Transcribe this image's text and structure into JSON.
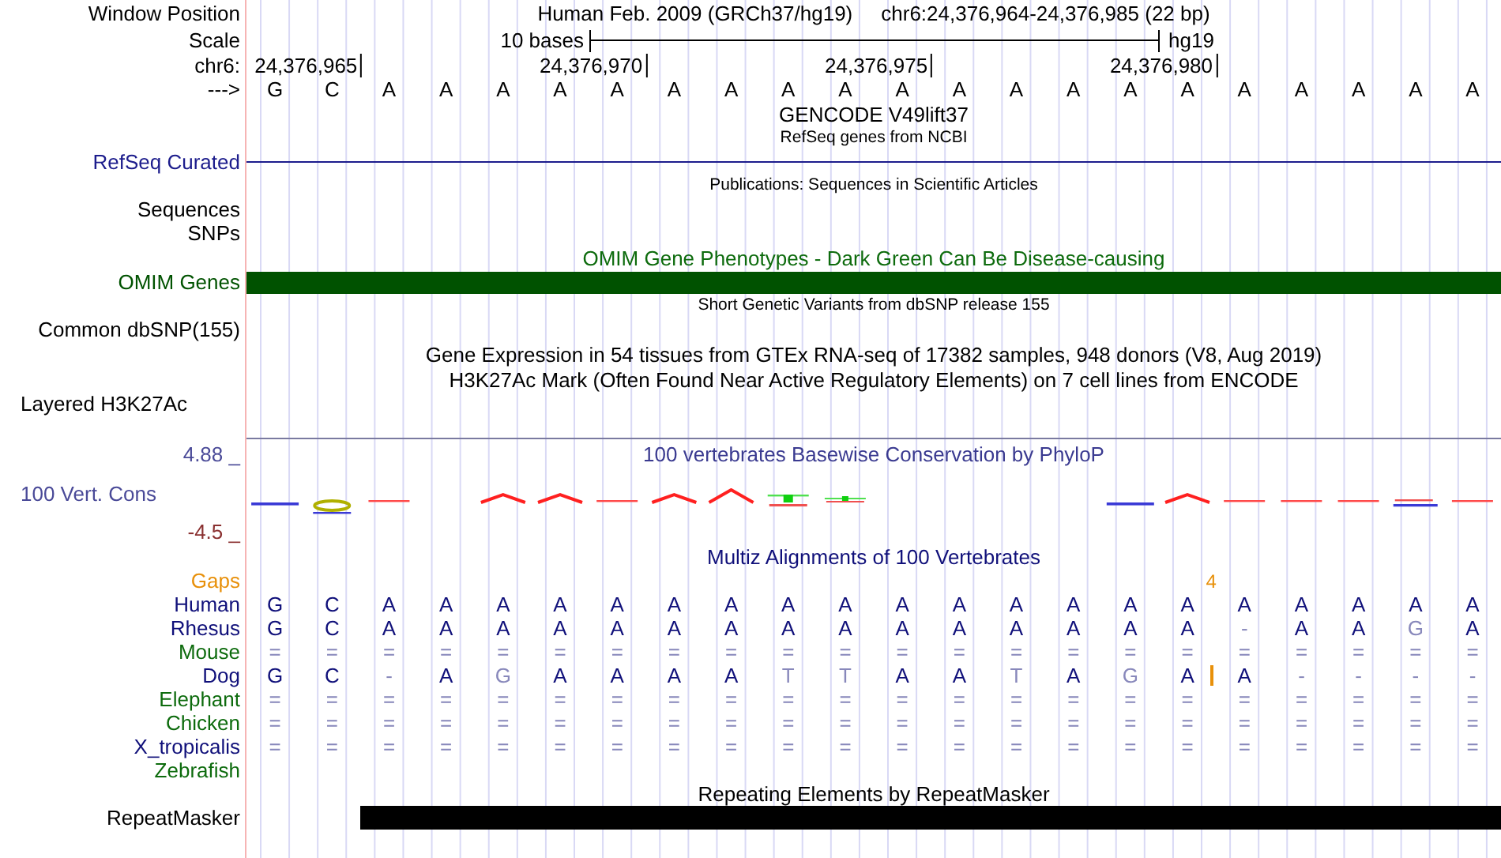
{
  "header": {
    "label": "Window Position",
    "title": "Human Feb. 2009 (GRCh37/hg19)",
    "position": "chr6:24,376,964-24,376,985 (22 bp)"
  },
  "scale": {
    "label": "Scale",
    "length": "10 bases",
    "assembly": "hg19"
  },
  "ruler": {
    "label": "chr6:",
    "ticks": [
      "24,376,965",
      "24,376,970",
      "24,376,975",
      "24,376,980"
    ]
  },
  "sequence": {
    "label": "--->",
    "bases": [
      "G",
      "C",
      "A",
      "A",
      "A",
      "A",
      "A",
      "A",
      "A",
      "A",
      "A",
      "A",
      "A",
      "A",
      "A",
      "A",
      "A",
      "A",
      "A",
      "A",
      "A",
      "A"
    ]
  },
  "tracks": [
    {
      "kind": "title",
      "text": "GENCODE V49lift37"
    },
    {
      "kind": "note",
      "text": "RefSeq genes from NCBI"
    },
    {
      "kind": "line",
      "label": "RefSeq Curated",
      "color": "#1c1c8c"
    },
    {
      "kind": "note",
      "text": "Publications: Sequences in Scientific Articles"
    },
    {
      "kind": "label",
      "label": "Sequences"
    },
    {
      "kind": "label",
      "label": "SNPs"
    },
    {
      "kind": "title",
      "text": "OMIM Gene Phenotypes - Dark Green Can Be Disease-causing",
      "color": "#0d6b0d"
    },
    {
      "kind": "bar",
      "label": "OMIM Genes",
      "color": "#005200"
    },
    {
      "kind": "note",
      "text": "Short Genetic Variants from dbSNP release 155"
    },
    {
      "kind": "label",
      "label": "Common dbSNP(155)"
    },
    {
      "kind": "title",
      "text": "Gene Expression in 54 tissues from GTEx RNA-seq of 17382 samples, 948 donors (V8, Aug 2019)"
    },
    {
      "kind": "title",
      "text": "H3K27Ac Mark (Often Found Near Active Regulatory Elements) on 7 cell lines from ENCODE"
    },
    {
      "kind": "left-label",
      "label": "Layered H3K27Ac"
    }
  ],
  "conservation": {
    "title": "100 vertebrates Basewise Conservation by PhyloP",
    "label": "100 Vert. Cons",
    "max": "4.88 _",
    "min": "-4.5 _"
  },
  "alignment": {
    "title": "Multiz Alignments of 100 Vertebrates",
    "gaps": {
      "label": "Gaps",
      "marks": [
        {
          "text": "4"
        }
      ]
    },
    "species": [
      {
        "name": "Human",
        "color": "#10107a",
        "bases": [
          {
            "b": "G",
            "match": true
          },
          {
            "b": "C",
            "match": true
          },
          {
            "b": "A",
            "match": true
          },
          {
            "b": "A",
            "match": true
          },
          {
            "b": "A",
            "match": true
          },
          {
            "b": "A",
            "match": true
          },
          {
            "b": "A",
            "match": true
          },
          {
            "b": "A",
            "match": true
          },
          {
            "b": "A",
            "match": true
          },
          {
            "b": "A",
            "match": true
          },
          {
            "b": "A",
            "match": true
          },
          {
            "b": "A",
            "match": true
          },
          {
            "b": "A",
            "match": true
          },
          {
            "b": "A",
            "match": true
          },
          {
            "b": "A",
            "match": true
          },
          {
            "b": "A",
            "match": true
          },
          {
            "b": "A",
            "match": true
          },
          {
            "b": "A",
            "match": true
          },
          {
            "b": "A",
            "match": true
          },
          {
            "b": "A",
            "match": true
          },
          {
            "b": "A",
            "match": true
          },
          {
            "b": "A",
            "match": true
          }
        ]
      },
      {
        "name": "Rhesus",
        "color": "#10107a",
        "bases": [
          {
            "b": "G",
            "match": true
          },
          {
            "b": "C",
            "match": true
          },
          {
            "b": "A",
            "match": true
          },
          {
            "b": "A",
            "match": true
          },
          {
            "b": "A",
            "match": true
          },
          {
            "b": "A",
            "match": true
          },
          {
            "b": "A",
            "match": true
          },
          {
            "b": "A",
            "match": true
          },
          {
            "b": "A",
            "match": true
          },
          {
            "b": "A",
            "match": true
          },
          {
            "b": "A",
            "match": true
          },
          {
            "b": "A",
            "match": true
          },
          {
            "b": "A",
            "match": true
          },
          {
            "b": "A",
            "match": true
          },
          {
            "b": "A",
            "match": true
          },
          {
            "b": "A",
            "match": true
          },
          {
            "b": "A",
            "match": true
          },
          {
            "b": "-",
            "match": false
          },
          {
            "b": "A",
            "match": true
          },
          {
            "b": "A",
            "match": true
          },
          {
            "b": "G",
            "match": false
          },
          {
            "b": "A",
            "match": true
          }
        ]
      },
      {
        "name": "Mouse",
        "color": "#0d6b0d",
        "bases": [
          {
            "b": "=",
            "match": false
          },
          {
            "b": "=",
            "match": false
          },
          {
            "b": "=",
            "match": false
          },
          {
            "b": "=",
            "match": false
          },
          {
            "b": "=",
            "match": false
          },
          {
            "b": "=",
            "match": false
          },
          {
            "b": "=",
            "match": false
          },
          {
            "b": "=",
            "match": false
          },
          {
            "b": "=",
            "match": false
          },
          {
            "b": "=",
            "match": false
          },
          {
            "b": "=",
            "match": false
          },
          {
            "b": "=",
            "match": false
          },
          {
            "b": "=",
            "match": false
          },
          {
            "b": "=",
            "match": false
          },
          {
            "b": "=",
            "match": false
          },
          {
            "b": "=",
            "match": false
          },
          {
            "b": "=",
            "match": false
          },
          {
            "b": "=",
            "match": false
          },
          {
            "b": "=",
            "match": false
          },
          {
            "b": "=",
            "match": false
          },
          {
            "b": "=",
            "match": false
          },
          {
            "b": "=",
            "match": false
          }
        ]
      },
      {
        "name": "Dog",
        "color": "#10107a",
        "bases": [
          {
            "b": "G",
            "match": true
          },
          {
            "b": "C",
            "match": true
          },
          {
            "b": "-",
            "match": false
          },
          {
            "b": "A",
            "match": true
          },
          {
            "b": "G",
            "match": false
          },
          {
            "b": "A",
            "match": true
          },
          {
            "b": "A",
            "match": true
          },
          {
            "b": "A",
            "match": true
          },
          {
            "b": "A",
            "match": true
          },
          {
            "b": "T",
            "match": false
          },
          {
            "b": "T",
            "match": false
          },
          {
            "b": "A",
            "match": true
          },
          {
            "b": "A",
            "match": true
          },
          {
            "b": "T",
            "match": false
          },
          {
            "b": "A",
            "match": true
          },
          {
            "b": "G",
            "match": false
          },
          {
            "b": "A",
            "match": true
          },
          {
            "b": "A",
            "match": true,
            "insert": true
          },
          {
            "b": "-",
            "match": false
          },
          {
            "b": "-",
            "match": false
          },
          {
            "b": "-",
            "match": false
          },
          {
            "b": "-",
            "match": false
          }
        ]
      },
      {
        "name": "Elephant",
        "color": "#0d6b0d",
        "bases": [
          {
            "b": "=",
            "match": false
          },
          {
            "b": "=",
            "match": false
          },
          {
            "b": "=",
            "match": false
          },
          {
            "b": "=",
            "match": false
          },
          {
            "b": "=",
            "match": false
          },
          {
            "b": "=",
            "match": false
          },
          {
            "b": "=",
            "match": false
          },
          {
            "b": "=",
            "match": false
          },
          {
            "b": "=",
            "match": false
          },
          {
            "b": "=",
            "match": false
          },
          {
            "b": "=",
            "match": false
          },
          {
            "b": "=",
            "match": false
          },
          {
            "b": "=",
            "match": false
          },
          {
            "b": "=",
            "match": false
          },
          {
            "b": "=",
            "match": false
          },
          {
            "b": "=",
            "match": false
          },
          {
            "b": "=",
            "match": false
          },
          {
            "b": "=",
            "match": false
          },
          {
            "b": "=",
            "match": false
          },
          {
            "b": "=",
            "match": false
          },
          {
            "b": "=",
            "match": false
          },
          {
            "b": "=",
            "match": false
          }
        ]
      },
      {
        "name": "Chicken",
        "color": "#0d6b0d",
        "bases": [
          {
            "b": "=",
            "match": false
          },
          {
            "b": "=",
            "match": false
          },
          {
            "b": "=",
            "match": false
          },
          {
            "b": "=",
            "match": false
          },
          {
            "b": "=",
            "match": false
          },
          {
            "b": "=",
            "match": false
          },
          {
            "b": "=",
            "match": false
          },
          {
            "b": "=",
            "match": false
          },
          {
            "b": "=",
            "match": false
          },
          {
            "b": "=",
            "match": false
          },
          {
            "b": "=",
            "match": false
          },
          {
            "b": "=",
            "match": false
          },
          {
            "b": "=",
            "match": false
          },
          {
            "b": "=",
            "match": false
          },
          {
            "b": "=",
            "match": false
          },
          {
            "b": "=",
            "match": false
          },
          {
            "b": "=",
            "match": false
          },
          {
            "b": "=",
            "match": false
          },
          {
            "b": "=",
            "match": false
          },
          {
            "b": "=",
            "match": false
          },
          {
            "b": "=",
            "match": false
          },
          {
            "b": "=",
            "match": false
          }
        ]
      },
      {
        "name": "X_tropicalis",
        "color": "#10107a",
        "bases": [
          {
            "b": "=",
            "match": false
          },
          {
            "b": "=",
            "match": false
          },
          {
            "b": "=",
            "match": false
          },
          {
            "b": "=",
            "match": false
          },
          {
            "b": "=",
            "match": false
          },
          {
            "b": "=",
            "match": false
          },
          {
            "b": "=",
            "match": false
          },
          {
            "b": "=",
            "match": false
          },
          {
            "b": "=",
            "match": false
          },
          {
            "b": "=",
            "match": false
          },
          {
            "b": "=",
            "match": false
          },
          {
            "b": "=",
            "match": false
          },
          {
            "b": "=",
            "match": false
          },
          {
            "b": "=",
            "match": false
          },
          {
            "b": "=",
            "match": false
          },
          {
            "b": "=",
            "match": false
          },
          {
            "b": "=",
            "match": false
          },
          {
            "b": "=",
            "match": false
          },
          {
            "b": "=",
            "match": false
          },
          {
            "b": "=",
            "match": false
          },
          {
            "b": "=",
            "match": false
          },
          {
            "b": "=",
            "match": false
          }
        ]
      },
      {
        "name": "Zebrafish",
        "color": "#0d6b0d"
      }
    ]
  },
  "repeats": {
    "title": "Repeating Elements by RepeatMasker",
    "label": "RepeatMasker",
    "covered": [
      false,
      false,
      true,
      true,
      true,
      true,
      true,
      true,
      true,
      true,
      true,
      true,
      true,
      true,
      true,
      true,
      true,
      true,
      true,
      true,
      true,
      true
    ]
  }
}
